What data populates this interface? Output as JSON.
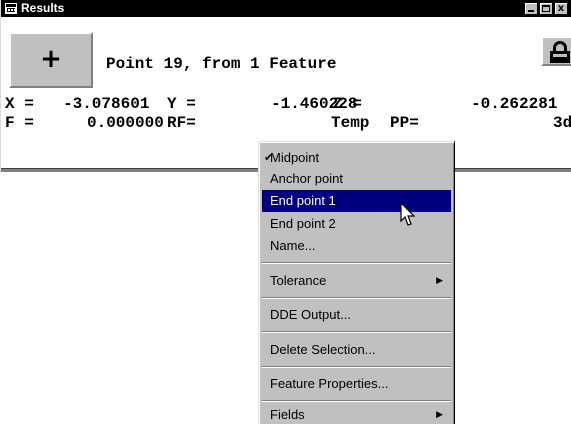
{
  "window": {
    "title": "Results",
    "close_glyph": "x"
  },
  "toolbar": {
    "crosshair_glyph": "+",
    "heading": "Point 19, from 1 Feature"
  },
  "fields": {
    "row1": [
      {
        "label": "X =",
        "value": "-3.078601"
      },
      {
        "label": "Y =",
        "value": "-1.460228"
      },
      {
        "label": "Z =",
        "value": "-0.262281"
      }
    ],
    "row2": [
      {
        "label": "F =",
        "value": "0.000000"
      },
      {
        "label": "RF=",
        "value": "Temp"
      },
      {
        "label": "PP=",
        "value": "3d"
      }
    ]
  },
  "menu": {
    "items": [
      {
        "label": "Midpoint",
        "checked": true
      },
      {
        "label": "Anchor point"
      },
      {
        "label": "End point 1",
        "highlighted": true
      },
      {
        "label": "End point 2"
      },
      {
        "label": "Name..."
      },
      {
        "label": "Tolerance",
        "submenu": true
      },
      {
        "label": "DDE Output..."
      },
      {
        "label": "Delete Selection..."
      },
      {
        "label": "Feature Properties..."
      },
      {
        "label": "Fields",
        "submenu": true
      }
    ],
    "check_glyph": "✔",
    "submenu_glyph": "▶"
  },
  "colors": {
    "titlebar": "#000000",
    "menu_bg": "#c0c0c0",
    "highlight": "#000080"
  },
  "icons": [
    "results-window-icon",
    "crosshair-icon",
    "lock-icon",
    "minimize-icon",
    "maximize-icon",
    "close-icon",
    "checkmark-icon",
    "submenu-arrow-icon",
    "mouse-cursor-icon"
  ]
}
